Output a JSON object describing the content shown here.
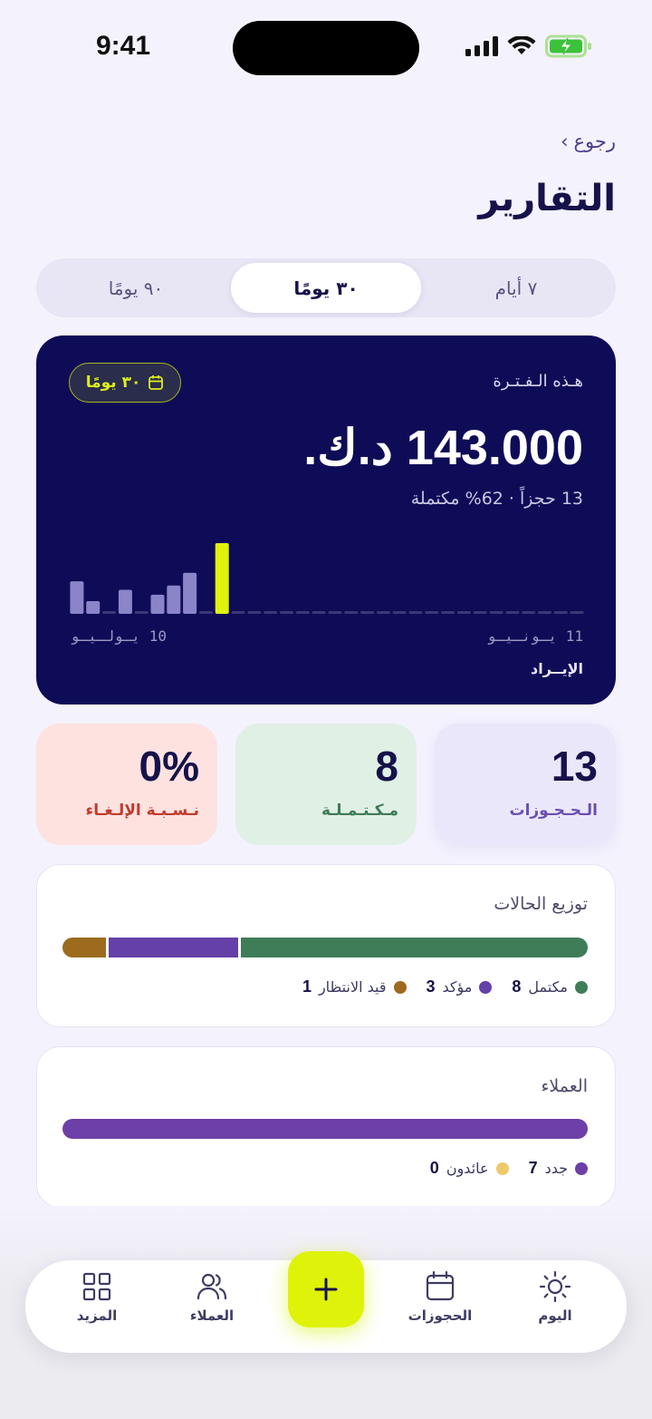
{
  "status_bar": {
    "time": "9:41"
  },
  "header": {
    "back_label": "رجوع",
    "back_chevron": "›",
    "title": "التقارير"
  },
  "period_tabs": [
    {
      "label": "٩٠ يومًا",
      "active": false
    },
    {
      "label": "٣٠ يومًا",
      "active": true
    },
    {
      "label": "٧ أيام",
      "active": false
    }
  ],
  "revenue": {
    "period_label": "هـذه الـفـتـرة",
    "pill_label": "٣٠ يومًا",
    "amount": "143.000 د.ك.",
    "subtitle": "13 حجزاً · 62% مكتملة",
    "x_start": "11 يـونـيـو",
    "x_end": "10 يـولـيـو",
    "footer": "الإيــراد"
  },
  "chart_data": {
    "type": "bar",
    "title": "",
    "xlabel": "الإيــراد",
    "ylabel": "",
    "x_range_labels": [
      "11 يـونـيـو",
      "10 يـولـيـو"
    ],
    "values": [
      0,
      0,
      0,
      0,
      0,
      0,
      0,
      0,
      0,
      0,
      0,
      0,
      0,
      0,
      0,
      0,
      0,
      0,
      0,
      0,
      0,
      0,
      1.0,
      0,
      0.58,
      0.4,
      0.27,
      0,
      0.34,
      0,
      0.18,
      0.46
    ],
    "highlight_index": 22,
    "bar_color": "#8a84c9",
    "highlight_color": "#dff20a",
    "empty_color": "#3a3878"
  },
  "stats": [
    {
      "value": "13",
      "label": "الـحـجـوزات",
      "bg": "#ebe7fb",
      "label_color": "#6a4fb0"
    },
    {
      "value": "8",
      "label": "مـكـتـمـلـة",
      "bg": "#e0f0e5",
      "label_color": "#3e7b55"
    },
    {
      "value": "0%",
      "label": "نـسـبـة الإلـغـاء",
      "bg": "#fde2e0",
      "label_color": "#c13a2c"
    }
  ],
  "status_distribution": {
    "title": "توزيع الحالات",
    "segments": [
      {
        "label": "مكتمل",
        "count": "8",
        "color": "#3f7d58"
      },
      {
        "label": "مؤكد",
        "count": "3",
        "color": "#6540a8"
      },
      {
        "label": "قيد الانتظار",
        "count": "1",
        "color": "#9c6b1e"
      }
    ]
  },
  "customers": {
    "title": "العملاء",
    "segments": [
      {
        "label": "جدد",
        "count": "7",
        "color": "#6d3fa8"
      },
      {
        "label": "عائدون",
        "count": "0",
        "color": "#ecc96a"
      }
    ]
  },
  "bottom_nav": {
    "items": [
      {
        "label": "اليوم",
        "icon": "sun-icon"
      },
      {
        "label": "الحجوزات",
        "icon": "calendar-icon"
      },
      {
        "label": "العملاء",
        "icon": "users-icon"
      },
      {
        "label": "المزيد",
        "icon": "grid-icon"
      }
    ],
    "fab_icon": "plus-icon"
  }
}
